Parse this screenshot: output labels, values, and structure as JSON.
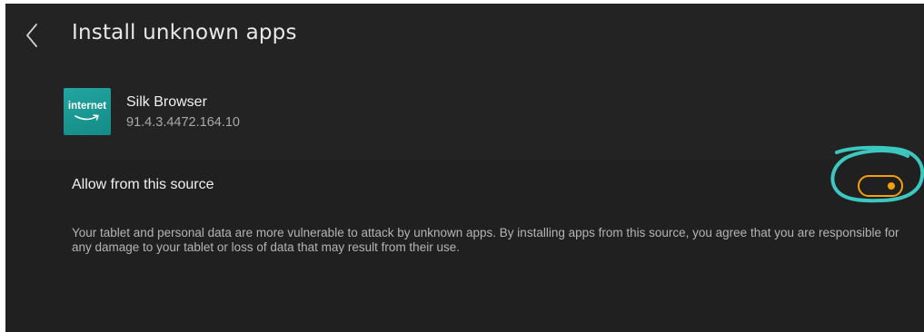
{
  "header": {
    "title": "Install unknown apps"
  },
  "app": {
    "icon_text": "internet",
    "name": "Silk Browser",
    "version": "91.4.3.4472.164.10"
  },
  "setting": {
    "label": "Allow from this source",
    "enabled": true
  },
  "warning": {
    "text": "Your tablet and personal data are more vulnerable to attack by unknown apps. By installing apps from this source, you agree that you are responsible for any damage to your tablet or loss of data that may result from their use."
  },
  "colors": {
    "background": "#202020",
    "accent": "#f5a00a",
    "annotation": "#3cc8c0",
    "icon_teal": "#1a9a95"
  },
  "icons": {
    "back": "chevron-left-icon",
    "app": "silk-browser-icon"
  }
}
